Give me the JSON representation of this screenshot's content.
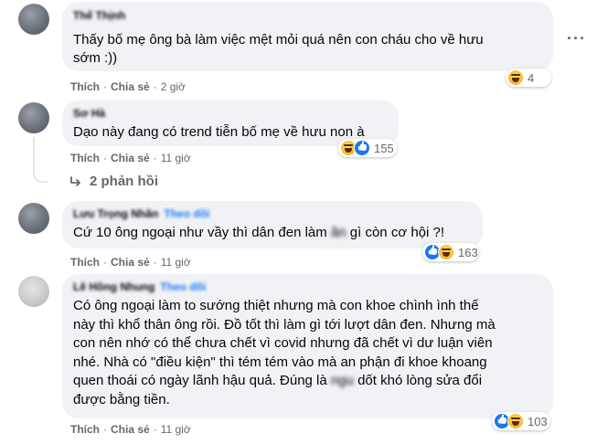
{
  "comments": [
    {
      "name": "Thế Thịnh",
      "follow": "",
      "lines": [
        "Thấy bố mẹ ông bà làm việc mệt mỏi quá nên con cháu cho về hưu",
        "sớm :))"
      ],
      "like_label": "Thích",
      "reply_label": "Chia sẻ",
      "time": "2 giờ",
      "reaction_icons": [
        "haha-icon"
      ],
      "reaction_count": "4",
      "more_label": "···"
    },
    {
      "name": "Sơ Hà",
      "follow": "",
      "lines": [
        "Dạo này đang có trend tiễn bố mẹ về hưu non à"
      ],
      "like_label": "Thích",
      "reply_label": "Chia sẻ",
      "time": "11 giờ",
      "reaction_icons": [
        "haha-icon",
        "like-icon"
      ],
      "reaction_count": "155",
      "replies_label": "2 phản hồi"
    },
    {
      "name": "Lưu Trọng Nhân",
      "follow": "Theo dõi",
      "line_pre": "Cứ 10 ông ngoại như vầy thì dân đen làm ",
      "line_blur": "ăn",
      "line_post": " gì còn cơ hội ?!",
      "like_label": "Thích",
      "reply_label": "Chia sẻ",
      "time": "11 giờ",
      "reaction_icons": [
        "like-icon",
        "haha-icon"
      ],
      "reaction_count": "163"
    },
    {
      "name": "Lê Hồng Nhung",
      "follow": "Theo dõi",
      "lines": [
        "Có ông ngoại làm to sướng thiệt nhưng mà con khoe chình ình thế",
        "này thì khổ thân ông rồi. Đồ tốt thì làm gì tới lượt dân đen. Nhưng mà",
        "con nên nhớ có thể chưa chết vì covid nhưng đã chết vì dư luận viên",
        "nhé. Nhà có \"điều kiện\" thì tém tém vào mà an phận đi khoe khoang"
      ],
      "line5_pre": "quen thoái có ngày lãnh hậu quả. Đúng là ",
      "line5_blur": "ngu",
      "line5_post": " dốt khó lòng sửa đổi",
      "line6": "được bằng tiền.",
      "like_label": "Thích",
      "reply_label": "Chia sẻ",
      "time": "11 giờ",
      "reaction_icons": [
        "like-icon",
        "haha-icon"
      ],
      "reaction_count": "103"
    }
  ]
}
